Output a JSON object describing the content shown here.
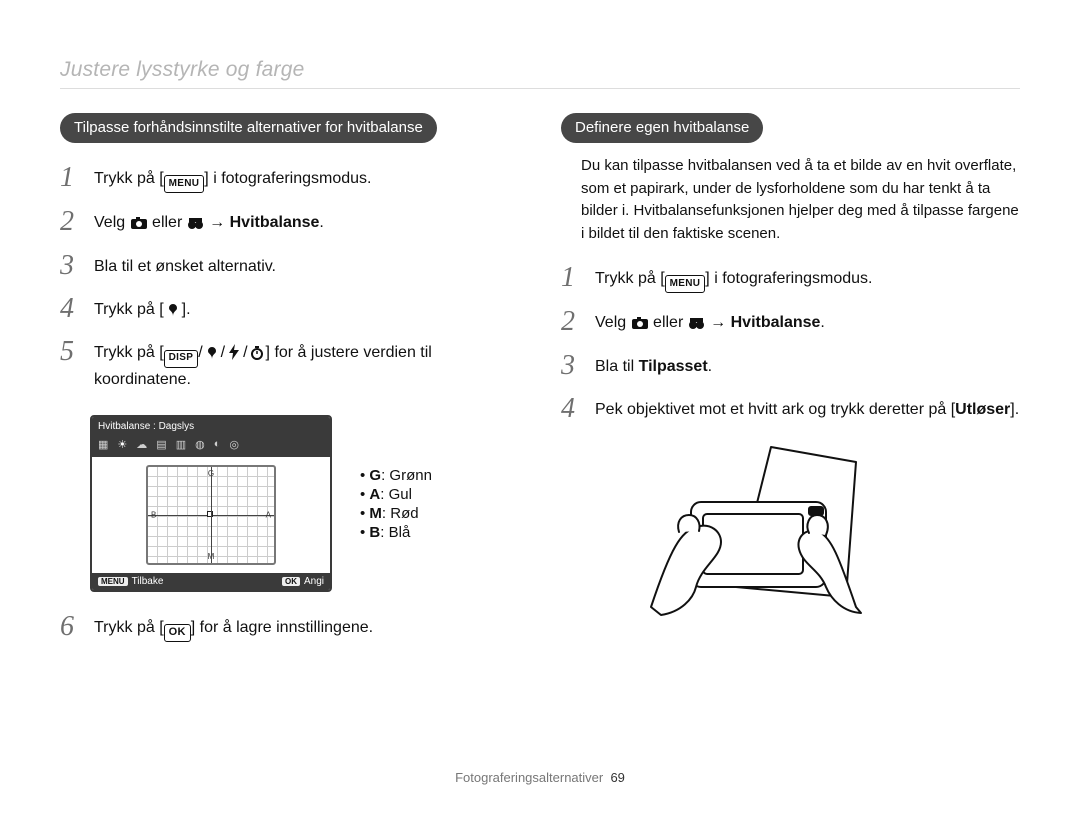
{
  "breadcrumb": "Justere lysstyrke og farge",
  "button_labels": {
    "menu": "MENU",
    "disp": "DISP",
    "ok": "OK"
  },
  "icons": {
    "camera": "camera-icon",
    "video": "video-icon",
    "macro": "macro-icon",
    "flash": "flash-icon",
    "timer": "timer-icon"
  },
  "left": {
    "pill": "Tilpasse forhåndsinnstilte alternativer for hvitbalanse",
    "steps": {
      "s1_a": "Trykk på [",
      "s1_b": "] i fotograferingsmodus.",
      "s2_a": "Velg ",
      "s2_b": " eller ",
      "s2_c": " → ",
      "s2_d": "Hvitbalanse",
      "s2_e": ".",
      "s3": "Bla til et ønsket alternativ.",
      "s4_a": "Trykk på [",
      "s4_b": "].",
      "s5_a": "Trykk på [",
      "s5_b": "/",
      "s5_c": "/",
      "s5_d": "/",
      "s5_e": "] for å justere verdien til koordinatene.",
      "s6_a": "Trykk på [",
      "s6_b": "] for å lagre innstillingene."
    },
    "screenshot": {
      "title": "Hvitbalanse : Dagslys",
      "back_label": "Tilbake",
      "back_button": "MENU",
      "set_label": "Angi",
      "set_button": "OK",
      "axes": {
        "G": "G",
        "A": "A",
        "B": "B",
        "M": "M"
      }
    },
    "legend": {
      "g_k": "G",
      "g_v": ": Grønn",
      "a_k": "A",
      "a_v": ": Gul",
      "m_k": "M",
      "m_v": ": Rød",
      "b_k": "B",
      "b_v": ": Blå"
    }
  },
  "right": {
    "pill": "Definere egen hvitbalanse",
    "intro": "Du kan tilpasse hvitbalansen ved å ta et bilde av en hvit overflate, som et papirark, under de lysforholdene som du har tenkt å ta bilder i. Hvitbalansefunksjonen hjelper deg med å tilpasse fargene i bildet til den faktiske scenen.",
    "steps": {
      "s1_a": "Trykk på [",
      "s1_b": "] i fotograferingsmodus.",
      "s2_a": "Velg ",
      "s2_b": " eller ",
      "s2_c": " → ",
      "s2_d": "Hvitbalanse",
      "s2_e": ".",
      "s3_a": "Bla til ",
      "s3_b": "Tilpasset",
      "s3_c": ".",
      "s4_a": "Pek objektivet mot et hvitt ark og trykk deretter på [",
      "s4_b": "Utløser",
      "s4_c": "]."
    }
  },
  "footer": {
    "section": "Fotograferingsalternativer",
    "page": "69"
  }
}
